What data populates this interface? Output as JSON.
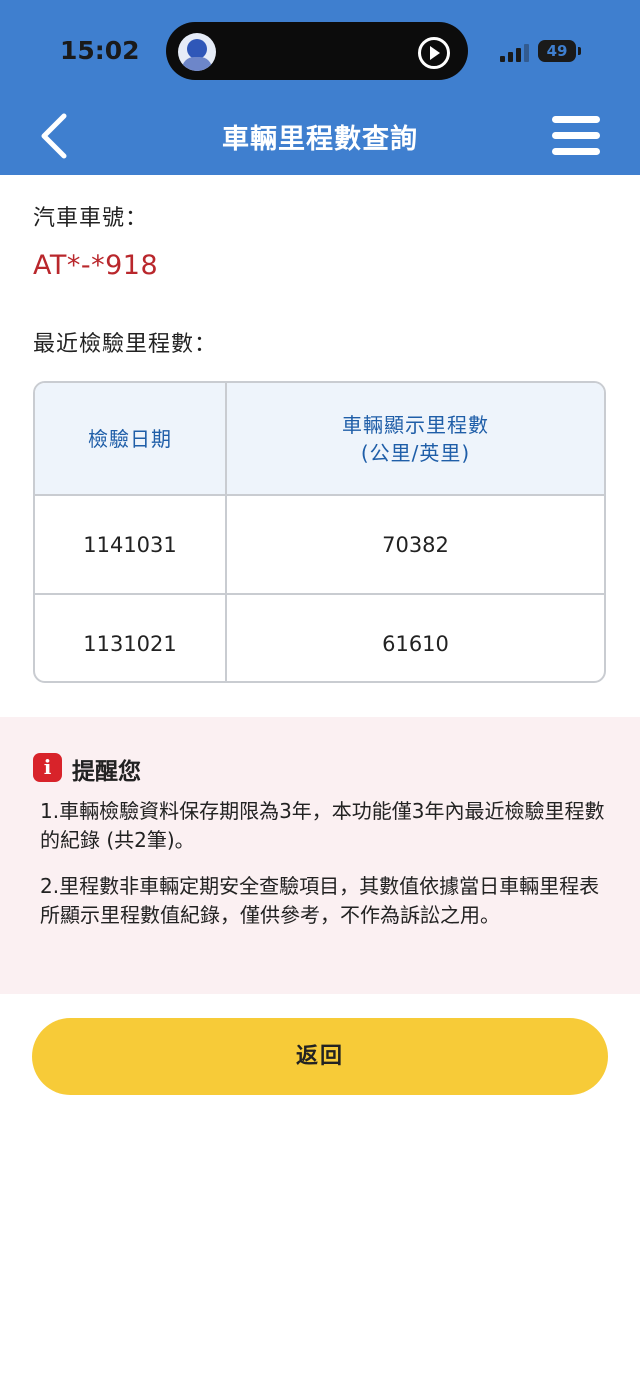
{
  "status_bar": {
    "time": "15:02",
    "battery": "49"
  },
  "header": {
    "title": "車輛里程數查詢",
    "back_icon": "chevron-left-icon",
    "menu_icon": "hamburger-menu-icon"
  },
  "vehicle": {
    "plate_label": "汽車車號：",
    "plate_value": "AT*-*918"
  },
  "mileage": {
    "section_label": "最近檢驗里程數：",
    "columns": [
      "檢驗日期",
      "車輛顯示里程數",
      "(公里/英里)"
    ],
    "rows": [
      {
        "date": "1141031",
        "mileage": "70382"
      },
      {
        "date": "1131021",
        "mileage": "61610"
      }
    ]
  },
  "reminder": {
    "title": "提醒您",
    "items": [
      "1.車輛檢驗資料保存期限為3年，本功能僅3年內最近檢驗里程數的紀錄 (共2筆)。",
      "2.里程數非車輛定期安全查驗項目，其數值依據當日車輛里程表所顯示里程數值紀錄，僅供參考，不作為訴訟之用。"
    ]
  },
  "actions": {
    "return_label": "返回"
  },
  "colors": {
    "header_blue": "#3f7fcf",
    "plate_red": "#b9272c",
    "button_yellow": "#f7cb38",
    "reminder_bg": "#fbf0f2"
  }
}
